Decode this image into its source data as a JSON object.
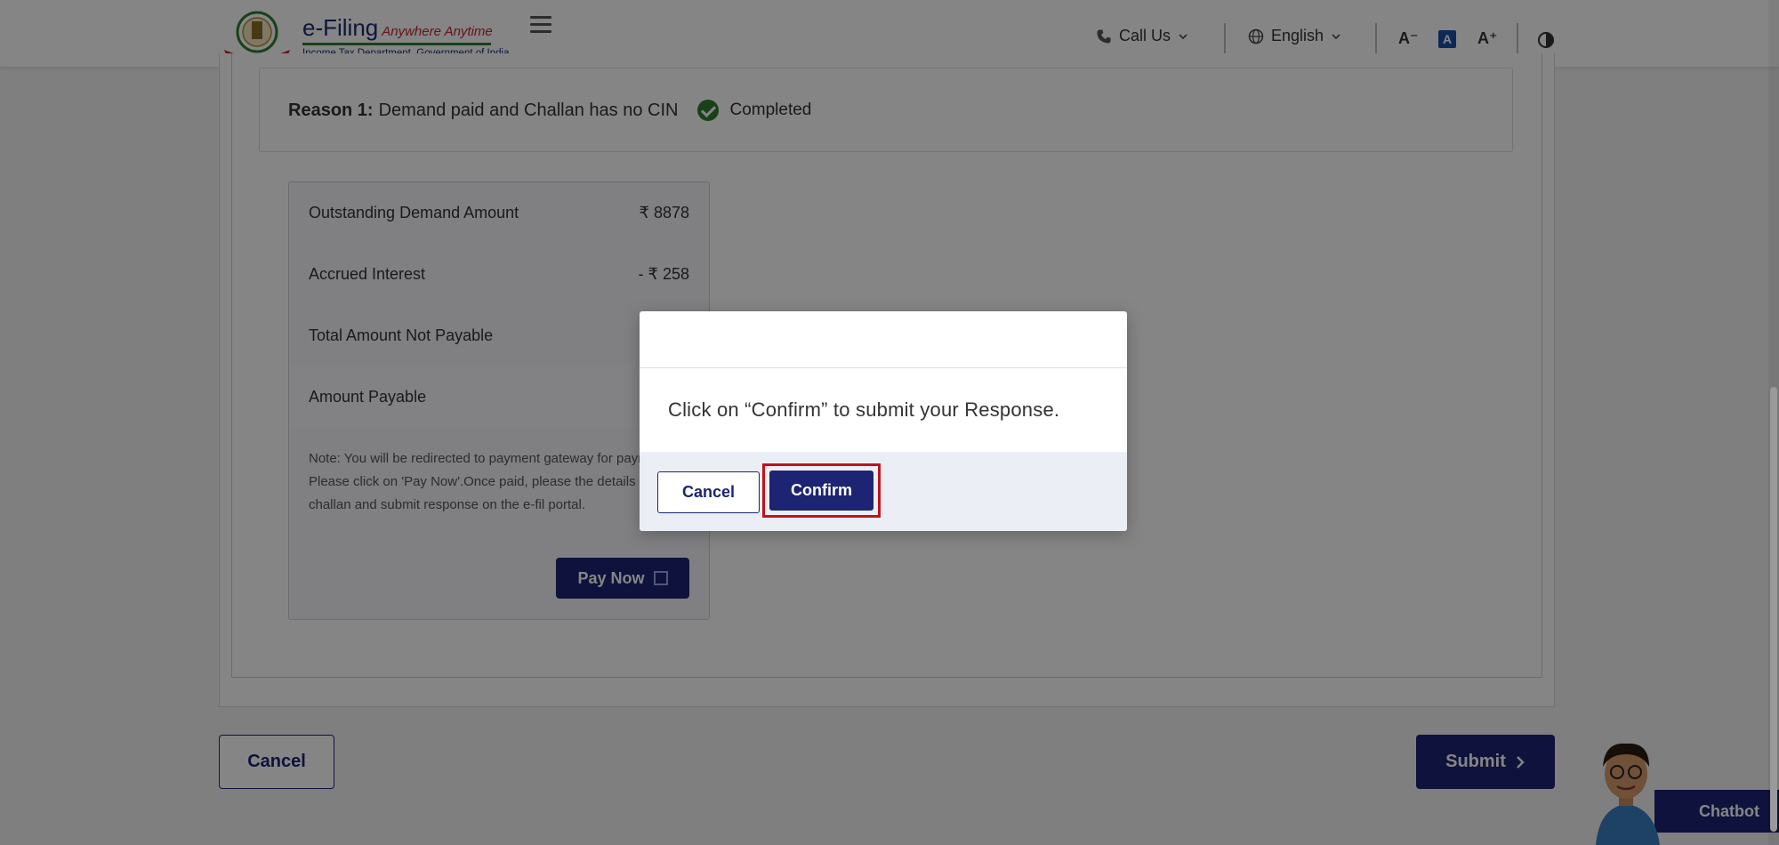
{
  "header": {
    "brand": "e-Filing",
    "tagline": "Anywhere Anytime",
    "subtitle": "Income Tax Department, Government of India",
    "call_us": "Call Us",
    "language": "English",
    "font_decrease": "A⁻",
    "font_normal": "A",
    "font_increase": "A⁺"
  },
  "reason": {
    "label": "Reason 1:",
    "text": "Demand paid and Challan has no CIN",
    "status": "Completed"
  },
  "amounts": [
    {
      "label": "Outstanding Demand Amount",
      "value": "₹ 8878"
    },
    {
      "label": "Accrued Interest",
      "value": "- ₹ 258"
    },
    {
      "label": "Total Amount Not Payable",
      "value": ""
    },
    {
      "label": "Amount Payable",
      "value": ""
    }
  ],
  "note": "Note: You will be redirected to payment gateway for payment. Please click on 'Pay Now'.Once paid, please the details of challan and submit response on the e-fil portal.",
  "pay_now_label": "Pay Now",
  "main_cancel_label": "Cancel",
  "main_submit_label": "Submit",
  "chatbot_label": "Chatbot",
  "modal": {
    "message": "Click on “Confirm” to submit your Response.",
    "cancel_label": "Cancel",
    "confirm_label": "Confirm"
  },
  "colors": {
    "primary": "#1c2473",
    "success": "#2e7d32",
    "highlight_border": "#c0121b"
  }
}
